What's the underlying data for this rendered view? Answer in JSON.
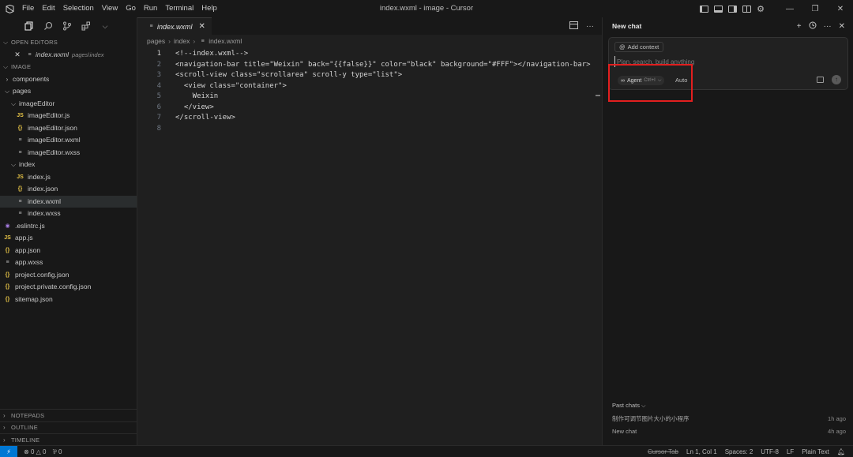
{
  "titlebar": {
    "menu": [
      "File",
      "Edit",
      "Selection",
      "View",
      "Go",
      "Run",
      "Terminal",
      "Help"
    ],
    "window_title": "index.wxml - image - Cursor",
    "icons": [
      "toggle-primary-sidebar-icon",
      "toggle-panel-icon",
      "toggle-secondary-sidebar-icon",
      "customize-layout-icon",
      "settings-icon"
    ],
    "window_buttons": [
      "minimize",
      "restore",
      "close"
    ]
  },
  "explorer": {
    "activity_icons": [
      "files-icon",
      "search-icon",
      "source-control-icon",
      "extensions-icon",
      "chevron-down-icon"
    ],
    "open_editors_label": "OPEN EDITORS",
    "open_editor": {
      "name": "index.wxml",
      "path": "pages\\index"
    },
    "project_label": "IMAGE",
    "tree": [
      {
        "label": "components",
        "type": "folder",
        "depth": 1,
        "expanded": false
      },
      {
        "label": "pages",
        "type": "folder",
        "depth": 1,
        "expanded": true
      },
      {
        "label": "imageEditor",
        "type": "folder",
        "depth": 2,
        "expanded": true
      },
      {
        "label": "imageEditor.js",
        "type": "js",
        "depth": 3
      },
      {
        "label": "imageEditor.json",
        "type": "json",
        "depth": 3
      },
      {
        "label": "imageEditor.wxml",
        "type": "lines",
        "depth": 3
      },
      {
        "label": "imageEditor.wxss",
        "type": "lines",
        "depth": 3
      },
      {
        "label": "index",
        "type": "folder",
        "depth": 2,
        "expanded": true
      },
      {
        "label": "index.js",
        "type": "js",
        "depth": 3
      },
      {
        "label": "index.json",
        "type": "json",
        "depth": 3
      },
      {
        "label": "index.wxml",
        "type": "lines",
        "depth": 3,
        "selected": true
      },
      {
        "label": "index.wxss",
        "type": "lines",
        "depth": 3
      },
      {
        "label": ".eslintrc.js",
        "type": "eslint",
        "depth": 1
      },
      {
        "label": "app.js",
        "type": "js",
        "depth": 1
      },
      {
        "label": "app.json",
        "type": "json",
        "depth": 1
      },
      {
        "label": "app.wxss",
        "type": "lines",
        "depth": 1
      },
      {
        "label": "project.config.json",
        "type": "json",
        "depth": 1
      },
      {
        "label": "project.private.config.json",
        "type": "json",
        "depth": 1
      },
      {
        "label": "sitemap.json",
        "type": "json",
        "depth": 1
      }
    ],
    "bottom_sections": [
      "NOTEPADS",
      "OUTLINE",
      "TIMELINE"
    ]
  },
  "editor": {
    "tab_label": "index.wxml",
    "breadcrumb": [
      "pages",
      "index",
      "index.wxml"
    ],
    "lines": [
      "<!--index.wxml-->",
      "<navigation-bar title=\"Weixin\" back=\"{{false}}\" color=\"black\" background=\"#FFF\"></navigation-bar>",
      "<scroll-view class=\"scrollarea\" scroll-y type=\"list\">",
      "  <view class=\"container\">",
      "    Weixin",
      "  </view>",
      "</scroll-view>",
      ""
    ],
    "active_line": 1
  },
  "chat": {
    "title": "New chat",
    "add_context_label": "Add context",
    "input_placeholder": "Plan, search, build anything",
    "agent_label": "Agent",
    "agent_shortcut": "Ctrl+I",
    "model_label": "Auto",
    "past_chats_label": "Past chats",
    "past_chats": [
      {
        "title": "制作可调节图片大小的小程序",
        "time": "1h ago"
      },
      {
        "title": "New chat",
        "time": "4h ago"
      }
    ],
    "highlight_color": "#e21f1f"
  },
  "statusbar": {
    "errors": "0",
    "warnings": "0",
    "ports": "0",
    "cursor_tab": "Cursor Tab",
    "position": "Ln 1, Col 1",
    "spaces": "Spaces: 2",
    "encoding": "UTF-8",
    "eol": "LF",
    "language": "Plain Text"
  }
}
